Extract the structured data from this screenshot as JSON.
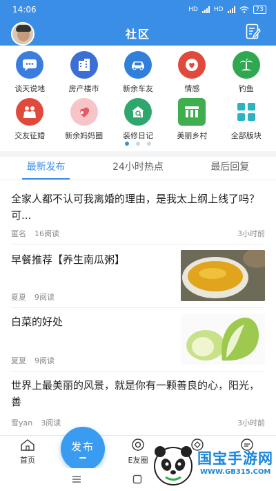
{
  "status_bar": {
    "time": "14:06",
    "signal_1": "HD",
    "signal_2": "HD",
    "battery": "73"
  },
  "header": {
    "title": "社区"
  },
  "categories": [
    {
      "label": "谈天说地",
      "icon": "chat-bubble-icon",
      "color": "#3b7ddd"
    },
    {
      "label": "房产楼市",
      "icon": "building-icon",
      "color": "#3b6fd6"
    },
    {
      "label": "新余车友",
      "icon": "car-icon",
      "color": "#2f7fdb"
    },
    {
      "label": "情感",
      "icon": "heart-face-icon",
      "color": "#e04a3c"
    },
    {
      "label": "钓鱼",
      "icon": "palm-tree-icon",
      "color": "#2fa84f"
    },
    {
      "label": "交友征婚",
      "icon": "couple-icon",
      "color": "#e04a3c"
    },
    {
      "label": "新余妈妈圈",
      "icon": "mother-heart-icon",
      "color": "#f3a0a6"
    },
    {
      "label": "装修日记",
      "icon": "house-search-icon",
      "color": "#2fa66b"
    },
    {
      "label": "美丽乡村",
      "icon": "village-icon",
      "color": "#3fae4e"
    },
    {
      "label": "全部版块",
      "icon": "grid-blocks-icon",
      "color": "#2bb3c0"
    }
  ],
  "tabs": [
    "最新发布",
    "24小时热点",
    "最后回复"
  ],
  "posts": [
    {
      "title": "全家人都不认可我离婚的理由，是我太上纲上线了吗？可...",
      "author": "匿名",
      "reads": "16阅读",
      "time": "3小时前"
    },
    {
      "title": "早餐推荐【养生南瓜粥】",
      "author": "夏夏",
      "reads": "9阅读",
      "image": "pumpkin-porridge-image"
    },
    {
      "title": "白菜的好处",
      "author": "夏夏",
      "reads": "9阅读",
      "image": "cabbage-image"
    },
    {
      "title": "世界上最美丽的风景，就是你有一颗善良的心，阳光，善",
      "author": "雪yan",
      "reads": "3阅读",
      "time": "3小时前"
    }
  ],
  "bottom_nav": {
    "home": "首页",
    "publish": "发布",
    "e_circle": "E友圈"
  },
  "watermark": {
    "text": "国宝手游网",
    "url": "WWW.GB315.COM"
  }
}
